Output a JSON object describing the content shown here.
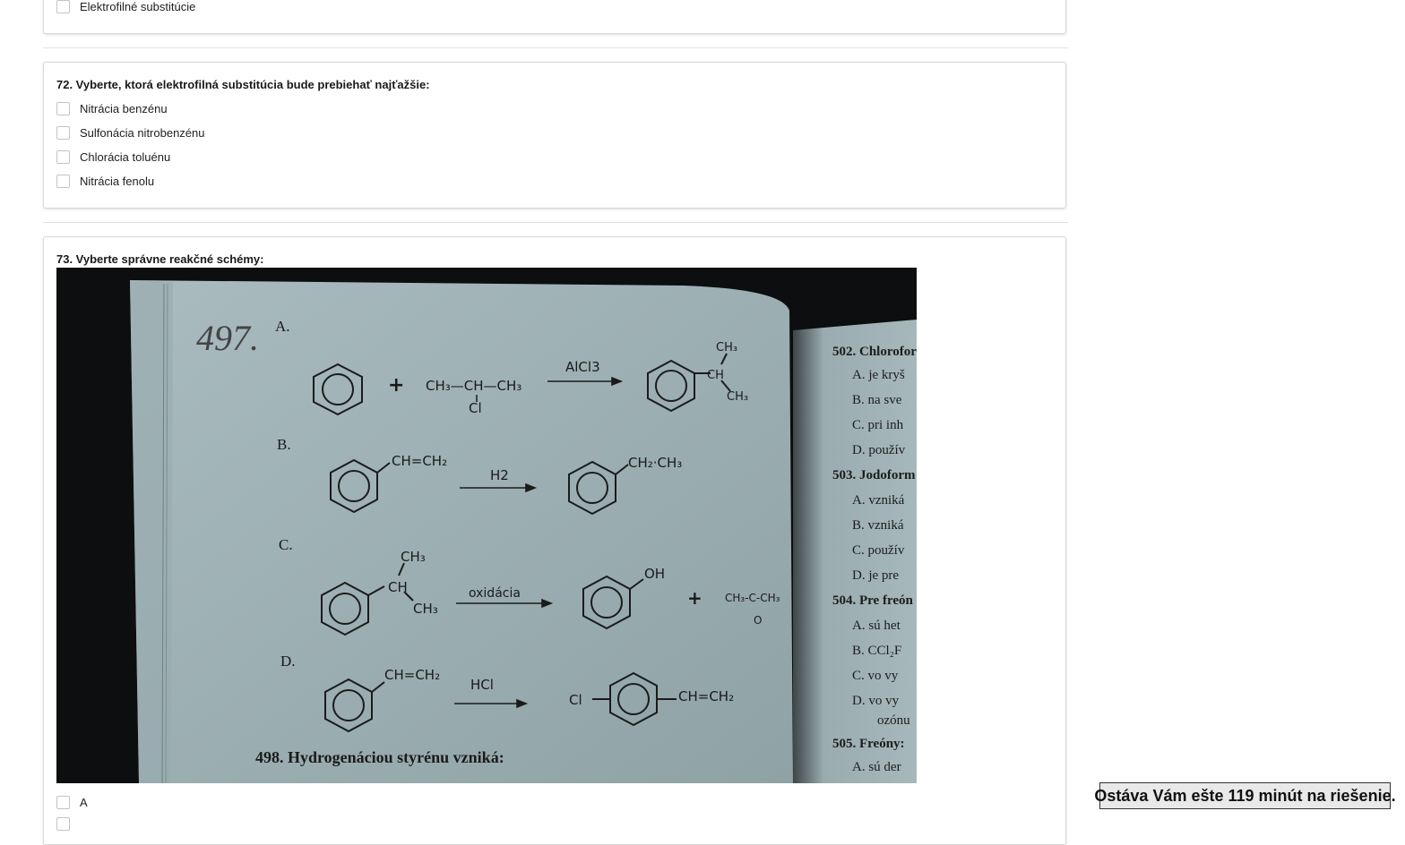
{
  "prev_question": {
    "last_option": "Elektrofilné substitúcie"
  },
  "q72": {
    "title": "72. Vyberte, ktorá elektrofilná substitúcia bude prebiehať najťažšie:",
    "options": [
      "Nitrácia benzénu",
      "Sulfonácia nitrobenzénu",
      "Chlorácia toluénu",
      "Nitrácia fenolu"
    ]
  },
  "q73": {
    "title": "73. Vyberte správne reakčné schémy:",
    "image": {
      "handwritten_number": "497.",
      "sections": [
        "A.",
        "B.",
        "C.",
        "D."
      ],
      "reagents": [
        "AlCl3",
        "H2",
        "oxidácia",
        "HCl"
      ],
      "next_heading": "498. Hydrogenáciou styrénu vzniká:",
      "right_page": [
        "502. Chlorofor",
        "A.  je kryš",
        "B.  na sve",
        "C.  pri inh",
        "D.  použív",
        "503. Jodoform",
        "A.  vzniká",
        "B.  vzniká",
        "C.  použív",
        "D.  je pre",
        "504. Pre freón",
        "A.  sú het",
        "B.  CCl₂F",
        "C.  vo vy",
        "D.  vo vy",
        "ozónu",
        "505. Freóny:",
        "A.  sú der"
      ]
    },
    "options": [
      "A",
      ""
    ]
  },
  "timer": {
    "text": "Ostáva Vám ešte 119 minút na riešenie."
  }
}
